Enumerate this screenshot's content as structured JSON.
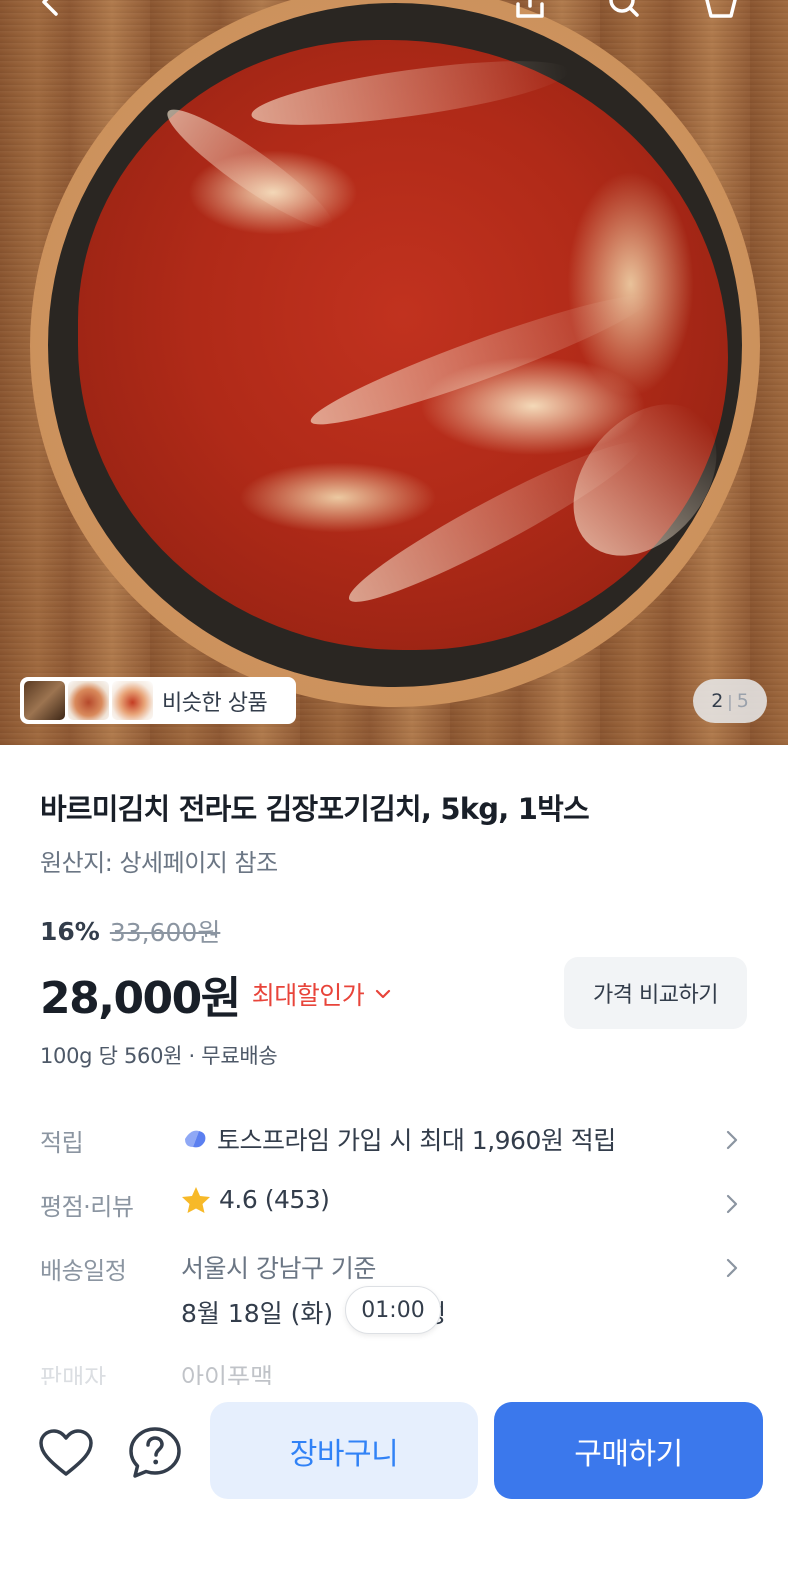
{
  "header": {
    "icons": [
      "back-icon",
      "share-icon",
      "search-icon",
      "cart-icon"
    ]
  },
  "gallery": {
    "similar_label": "비슷한 상품",
    "current_page": "2",
    "total_pages": "5"
  },
  "product": {
    "title": "바르미김치 전라도 김장포기김치, 5kg, 1박스",
    "origin": "원산지: 상세페이지 참조",
    "discount_rate": "16%",
    "original_price": "33,600원",
    "price": "28,000원",
    "best_price_label": "최대할인가",
    "compare_button": "가격 비교하기",
    "unit_price": "100g 당 560원 · 무료배송"
  },
  "info": {
    "points_label": "적립",
    "points_value": "토스프라임 가입 시 최대 1,960원 적립",
    "rating_label": "평점·리뷰",
    "rating_value": "4.6 (453)",
    "delivery_label": "배송일정",
    "delivery_value": "서울시 강남구 기준",
    "delivery_date": "8월 18일 (화) ",
    "delivery_suffix": "쳥",
    "time_tooltip": "01:00",
    "seller_label": "판매자",
    "seller_value": "아이푸맥"
  },
  "bottom": {
    "cart_button": "장바구니",
    "buy_button": "구매하기"
  },
  "colors": {
    "accent": "#3b78ec",
    "accent_light": "#e6effd",
    "discount_red": "#e8443a",
    "star": "#f7b928"
  }
}
